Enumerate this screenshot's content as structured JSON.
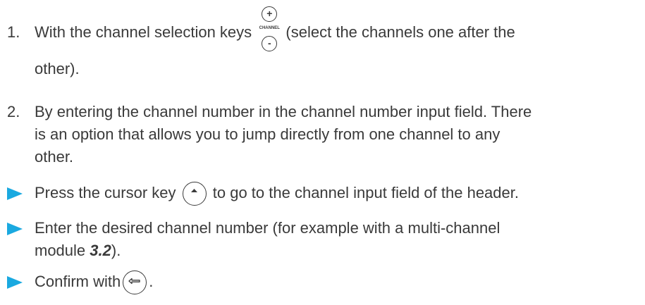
{
  "list": {
    "item1": {
      "number": "1.",
      "before": "With the channel selection keys",
      "after": "(select the channels one after the",
      "line2": "other).",
      "keys": {
        "plus": "+",
        "label": "CHANNEL",
        "minus": "-"
      }
    },
    "item2": {
      "number": "2.",
      "line1": "By entering the channel number in the channel number input field. There",
      "line2": "is an option that allows you to jump directly from one channel to any",
      "line3": "other."
    }
  },
  "steps": {
    "step1": {
      "before": "Press the cursor key",
      "after": "to go to the channel input field of the header.",
      "icon": "cursor-up-key-icon"
    },
    "step2": {
      "line1": "Enter the desired channel number (for example with a multi-channel",
      "line2_before": "module ",
      "line2_value": "3.2",
      "line2_after": ")."
    },
    "step3": {
      "before": "Confirm with",
      "after": ".",
      "icon": "enter-key-icon"
    }
  },
  "colors": {
    "bullet_arrow": "#1aa9e0",
    "text": "#3a3a3a"
  }
}
